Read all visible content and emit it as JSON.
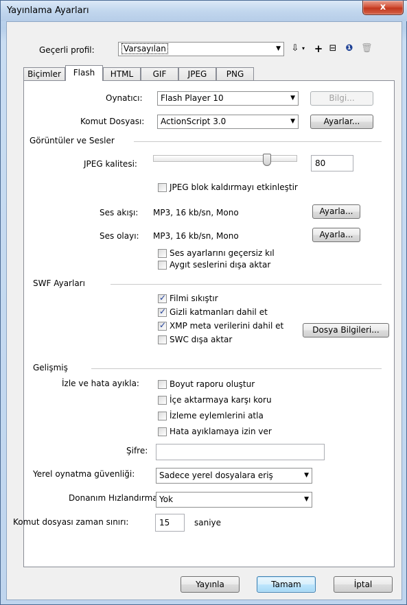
{
  "window": {
    "title": "Yayınlama Ayarları",
    "close_glyph": "x"
  },
  "profile": {
    "label": "Geçerli profil:",
    "value": "Varsayılan",
    "icons": [
      "import-export-icon",
      "add-icon",
      "duplicate-icon",
      "info-icon",
      "delete-icon"
    ]
  },
  "tabs": [
    "Biçimler",
    "Flash",
    "HTML",
    "GIF",
    "JPEG",
    "PNG"
  ],
  "active_tab": "Flash",
  "player": {
    "label": "Oynatıcı:",
    "value": "Flash Player 10",
    "info_button": "Bilgi..."
  },
  "script": {
    "label": "Komut Dosyası:",
    "value": "ActionScript 3.0",
    "settings_button": "Ayarlar..."
  },
  "images_sounds": {
    "header": "Görüntüler ve Sesler",
    "jpeg_quality_label": "JPEG kalitesi:",
    "jpeg_quality_value": "80",
    "jpeg_quality_fraction": 0.8,
    "jpeg_deblock": {
      "label": "JPEG blok kaldırmayı etkinleştir",
      "checked": false
    },
    "stream": {
      "label": "Ses akışı:",
      "value": "MP3, 16 kb/sn, Mono",
      "button": "Ayarla..."
    },
    "event": {
      "label": "Ses olayı:",
      "value": "MP3, 16 kb/sn, Mono",
      "button": "Ayarla..."
    },
    "override": {
      "label": "Ses ayarlarını geçersiz kıl",
      "checked": false
    },
    "export_device": {
      "label": "Aygıt seslerini dışa aktar",
      "checked": false
    }
  },
  "swf": {
    "header": "SWF Ayarları",
    "compress": {
      "label": "Filmi sıkıştır",
      "checked": true
    },
    "hidden_layers": {
      "label": "Gizli katmanları dahil et",
      "checked": true
    },
    "xmp": {
      "label": "XMP meta verilerini dahil et",
      "checked": true
    },
    "swc": {
      "label": "SWC dışa aktar",
      "checked": false
    },
    "file_info_button": "Dosya Bilgileri..."
  },
  "advanced": {
    "header": "Gelişmiş",
    "debug_label": "İzle ve hata ayıkla:",
    "size_report": {
      "label": "Boyut raporu oluştur",
      "checked": false
    },
    "protect_import": {
      "label": "İçe aktarmaya karşı koru",
      "checked": false
    },
    "omit_trace": {
      "label": "İzleme eylemlerini atla",
      "checked": false
    },
    "permit_debug": {
      "label": "Hata ayıklamaya izin ver",
      "checked": false
    },
    "password_label": "Şifre:",
    "password_value": "",
    "local_security_label": "Yerel oynatma güvenliği:",
    "local_security_value": "Sadece yerel dosyalara eriş",
    "hardware_label": "Donanım Hızlandırma:",
    "hardware_value": "Yok",
    "timeout_label": "Komut dosyası zaman sınırı:",
    "timeout_value": "15",
    "timeout_unit": "saniye"
  },
  "footer": {
    "publish": "Yayınla",
    "ok": "Tamam",
    "cancel": "İptal"
  }
}
